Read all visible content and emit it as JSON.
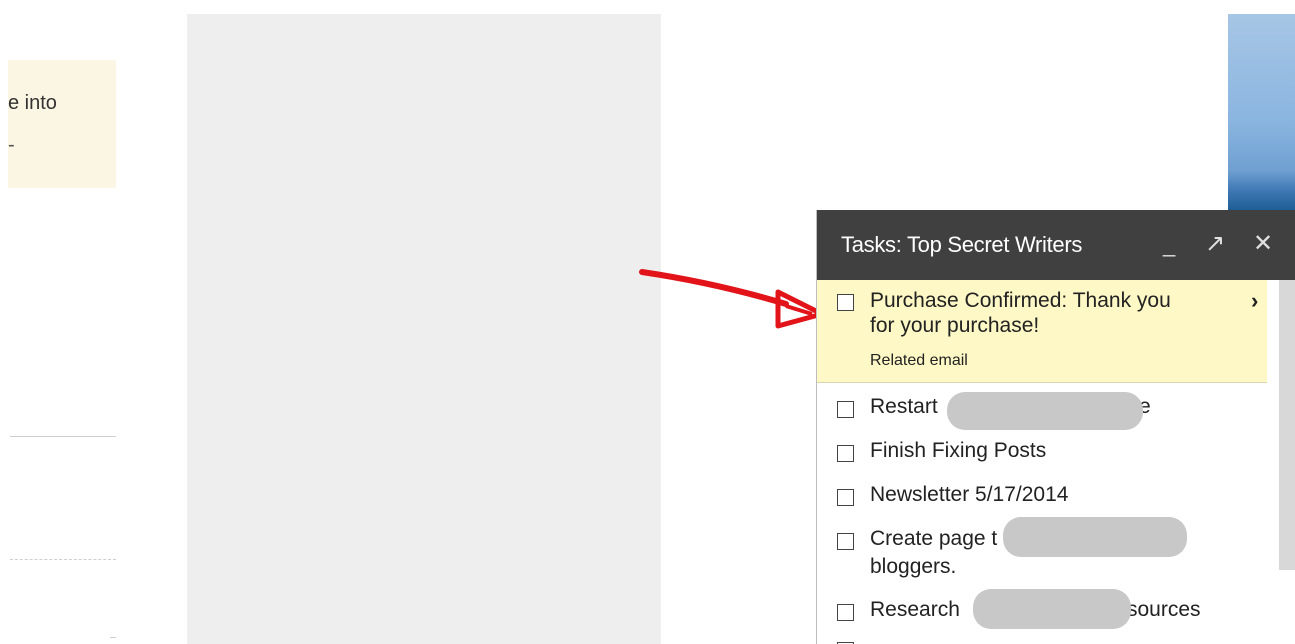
{
  "background": {
    "notice_line1": "e into",
    "notice_line2": "-"
  },
  "tasks_window": {
    "title": "Tasks: Top Secret Writers",
    "minimize_label": "_",
    "popout_label": "↗",
    "close_label": "✕",
    "tasks": [
      {
        "line1": "Purchase Confirmed: Thank you",
        "line2": "for your purchase!",
        "sub": "Related email",
        "selected": true,
        "chevron": "›"
      },
      {
        "line1": "Restart",
        "tail": "e"
      },
      {
        "line1": "Finish Fixing Posts"
      },
      {
        "line1": "Newsletter 5/17/2014"
      },
      {
        "line1": "Create page t",
        "line2": "bloggers."
      },
      {
        "line1": "Research",
        "tail": "sources"
      }
    ]
  },
  "colors": {
    "header_bg": "#404040",
    "selected_task_bg": "#fdf8c5",
    "annotation_arrow": "#e2141a"
  }
}
